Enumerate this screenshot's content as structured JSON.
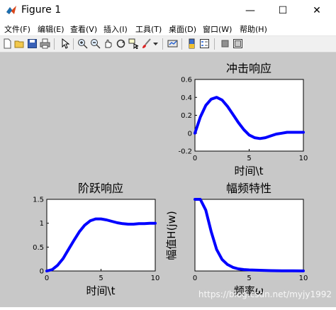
{
  "window": {
    "title": "Figure 1",
    "minimize": "—",
    "maximize": "☐",
    "close": "✕"
  },
  "menu": [
    "文件(F)",
    "编辑(E)",
    "查看(V)",
    "插入(I)",
    "工具(T)",
    "桌面(D)",
    "窗口(W)",
    "帮助(H)"
  ],
  "toolbar": {
    "icons": [
      "new-figure-icon",
      "open-file-icon",
      "save-icon",
      "print-icon",
      "pointer-icon",
      "zoom-in-icon",
      "zoom-out-icon",
      "pan-icon",
      "rotate-3d-icon",
      "data-cursor-icon",
      "brush-icon",
      "brush-dropdown-icon",
      "link-plot-icon",
      "insert-colorbar-icon",
      "insert-legend-icon",
      "hide-plot-tools-icon",
      "show-plot-tools-icon"
    ]
  },
  "colors": {
    "line": "#0000ff",
    "figure_bg": "#c8c8c8"
  },
  "watermark": "https://blog.csdn.net/myjy1992",
  "chart_data": [
    {
      "type": "line",
      "title": "冲击响应",
      "xlabel": "时间\\t",
      "ylabel": "",
      "xlim": [
        0,
        10
      ],
      "ylim": [
        -0.2,
        0.6
      ],
      "xticks": [
        "0",
        "5",
        "10"
      ],
      "yticks": [
        "-0.2",
        "0",
        "0.2",
        "0.4",
        "0.6"
      ],
      "x": [
        0,
        0.5,
        1,
        1.5,
        2,
        2.5,
        3,
        3.5,
        4,
        4.5,
        5,
        5.5,
        6,
        6.5,
        7,
        7.5,
        8,
        8.5,
        9,
        9.5,
        10
      ],
      "values": [
        0,
        0.18,
        0.31,
        0.38,
        0.4,
        0.37,
        0.3,
        0.21,
        0.12,
        0.04,
        -0.02,
        -0.05,
        -0.06,
        -0.05,
        -0.03,
        -0.01,
        0.0,
        0.01,
        0.01,
        0.01,
        0.01
      ]
    },
    {
      "type": "line",
      "title": "阶跃响应",
      "xlabel": "时间\\t",
      "ylabel": "",
      "xlim": [
        0,
        10
      ],
      "ylim": [
        0,
        1.5
      ],
      "xticks": [
        "0",
        "5",
        "10"
      ],
      "yticks": [
        "0",
        "0.5",
        "1",
        "1.5"
      ],
      "x": [
        0,
        0.5,
        1,
        1.5,
        2,
        2.5,
        3,
        3.5,
        4,
        4.5,
        5,
        5.5,
        6,
        6.5,
        7,
        7.5,
        8,
        8.5,
        9,
        9.5,
        10
      ],
      "values": [
        0,
        0.03,
        0.12,
        0.26,
        0.45,
        0.64,
        0.82,
        0.96,
        1.05,
        1.09,
        1.09,
        1.07,
        1.04,
        1.01,
        0.99,
        0.98,
        0.98,
        0.99,
        0.99,
        1.0,
        1.0
      ]
    },
    {
      "type": "line",
      "title": "幅频特性",
      "xlabel": "频率ω",
      "ylabel": "幅值H(jw)",
      "xlim": [
        0,
        10
      ],
      "ylim": [
        0,
        1
      ],
      "xticks": [
        "0",
        "5",
        "10"
      ],
      "yticks": [],
      "x": [
        0,
        0.5,
        1,
        1.5,
        2,
        2.5,
        3,
        3.5,
        4,
        4.5,
        5,
        6,
        7,
        8,
        9,
        10
      ],
      "values": [
        1.0,
        1.0,
        0.85,
        0.55,
        0.3,
        0.16,
        0.09,
        0.05,
        0.03,
        0.02,
        0.015,
        0.01,
        0.005,
        0.003,
        0.002,
        0.001
      ]
    }
  ]
}
